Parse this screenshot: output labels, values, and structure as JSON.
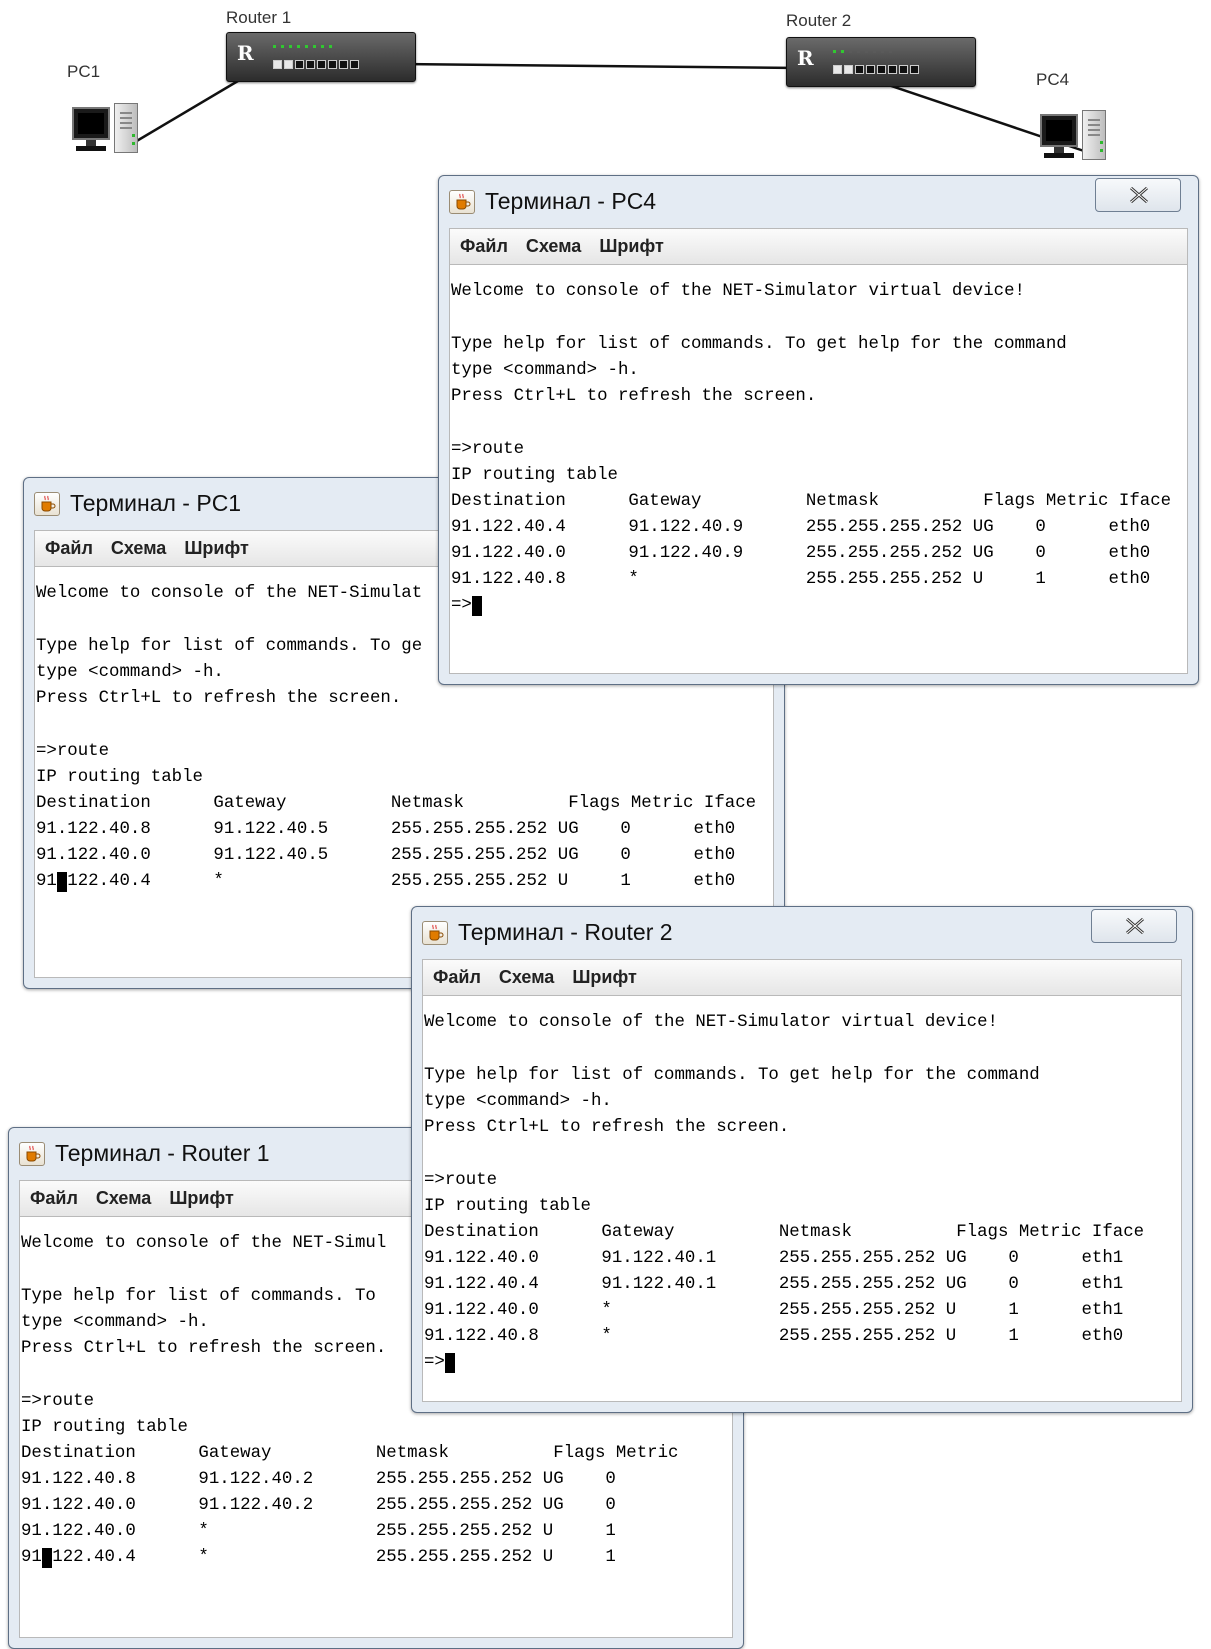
{
  "topology": {
    "devices": [
      {
        "id": "pc1",
        "label": "PC1"
      },
      {
        "id": "router1",
        "label": "Router 1"
      },
      {
        "id": "router2",
        "label": "Router 2"
      },
      {
        "id": "pc4",
        "label": "PC4"
      }
    ],
    "router_letter": "R"
  },
  "menu": {
    "file": "Файл",
    "scheme": "Схема",
    "font": "Шрифт"
  },
  "console": {
    "welcome": "Welcome to console of the NET-Simulator virtual device!",
    "help1": "Type help for list of commands. To get help for the command",
    "help2": "type <command> -h.",
    "help3": "Press Ctrl+L to refresh the screen.",
    "command": "=>route",
    "table_title": "IP routing table",
    "prompt": "=>"
  },
  "windows": {
    "pc4": {
      "title": "Терминал - PC4",
      "header": "Destination      Gateway          Netmask          Flags Metric Iface",
      "rows": [
        "91.122.40.4      91.122.40.9      255.255.255.252 UG    0      eth0",
        "91.122.40.0      91.122.40.9      255.255.255.252 UG    0      eth0",
        "91.122.40.8      *                255.255.255.252 U     1      eth0"
      ]
    },
    "pc1": {
      "title": "Терминал - PC1",
      "welcome": "Welcome to console of the NET-Simulat",
      "help1": "Type help for list of commands. To ge",
      "header": "Destination      Gateway          Netmask          Flags Metric Iface",
      "rows": [
        "91.122.40.8      91.122.40.5      255.255.255.252 UG    0      eth0",
        "91.122.40.0      91.122.40.5      255.255.255.252 UG    0      eth0",
        "91.122.40.4      *                255.255.255.252 U     1      eth0"
      ]
    },
    "router2": {
      "title": "Терминал - Router 2",
      "header": "Destination      Gateway          Netmask          Flags Metric Iface",
      "rows": [
        "91.122.40.0      91.122.40.1      255.255.255.252 UG    0      eth1",
        "91.122.40.4      91.122.40.1      255.255.255.252 UG    0      eth1",
        "91.122.40.0      *                255.255.255.252 U     1      eth1",
        "91.122.40.8      *                255.255.255.252 U     1      eth0"
      ]
    },
    "router1": {
      "title": "Терминал - Router 1",
      "welcome": "Welcome to console of the NET-Simul",
      "help1": "Type help for list of commands. To",
      "header": "Destination      Gateway          Netmask          Flags Metric",
      "rows": [
        "91.122.40.8      91.122.40.2      255.255.255.252 UG    0",
        "91.122.40.0      91.122.40.2      255.255.255.252 UG    0",
        "91.122.40.0      *                255.255.255.252 U     1",
        "91.122.40.4      *                255.255.255.252 U     1"
      ]
    }
  }
}
